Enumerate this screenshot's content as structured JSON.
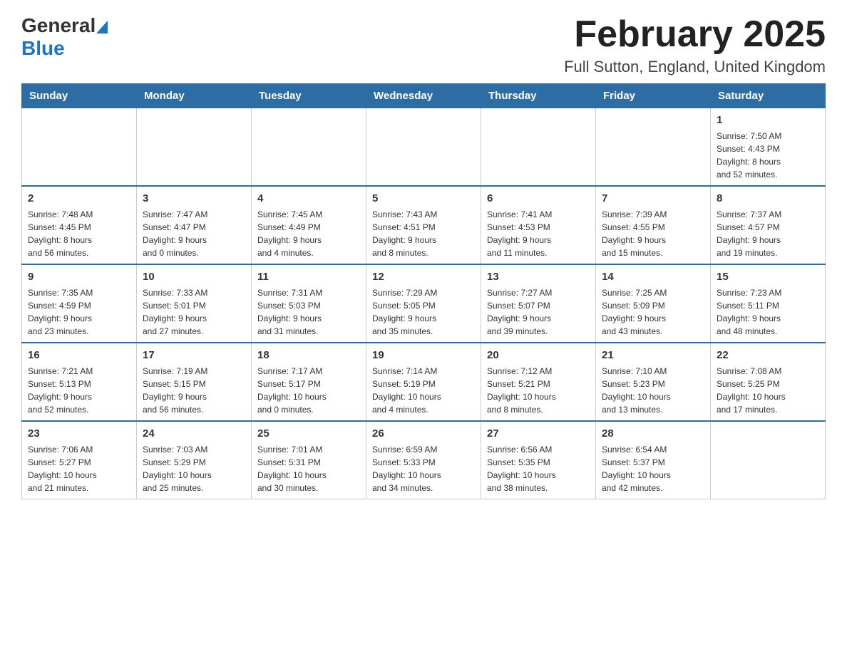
{
  "header": {
    "logo_general": "General",
    "logo_blue": "Blue",
    "month_title": "February 2025",
    "location": "Full Sutton, England, United Kingdom"
  },
  "weekdays": [
    "Sunday",
    "Monday",
    "Tuesday",
    "Wednesday",
    "Thursday",
    "Friday",
    "Saturday"
  ],
  "weeks": [
    [
      {
        "day": "",
        "info": ""
      },
      {
        "day": "",
        "info": ""
      },
      {
        "day": "",
        "info": ""
      },
      {
        "day": "",
        "info": ""
      },
      {
        "day": "",
        "info": ""
      },
      {
        "day": "",
        "info": ""
      },
      {
        "day": "1",
        "info": "Sunrise: 7:50 AM\nSunset: 4:43 PM\nDaylight: 8 hours\nand 52 minutes."
      }
    ],
    [
      {
        "day": "2",
        "info": "Sunrise: 7:48 AM\nSunset: 4:45 PM\nDaylight: 8 hours\nand 56 minutes."
      },
      {
        "day": "3",
        "info": "Sunrise: 7:47 AM\nSunset: 4:47 PM\nDaylight: 9 hours\nand 0 minutes."
      },
      {
        "day": "4",
        "info": "Sunrise: 7:45 AM\nSunset: 4:49 PM\nDaylight: 9 hours\nand 4 minutes."
      },
      {
        "day": "5",
        "info": "Sunrise: 7:43 AM\nSunset: 4:51 PM\nDaylight: 9 hours\nand 8 minutes."
      },
      {
        "day": "6",
        "info": "Sunrise: 7:41 AM\nSunset: 4:53 PM\nDaylight: 9 hours\nand 11 minutes."
      },
      {
        "day": "7",
        "info": "Sunrise: 7:39 AM\nSunset: 4:55 PM\nDaylight: 9 hours\nand 15 minutes."
      },
      {
        "day": "8",
        "info": "Sunrise: 7:37 AM\nSunset: 4:57 PM\nDaylight: 9 hours\nand 19 minutes."
      }
    ],
    [
      {
        "day": "9",
        "info": "Sunrise: 7:35 AM\nSunset: 4:59 PM\nDaylight: 9 hours\nand 23 minutes."
      },
      {
        "day": "10",
        "info": "Sunrise: 7:33 AM\nSunset: 5:01 PM\nDaylight: 9 hours\nand 27 minutes."
      },
      {
        "day": "11",
        "info": "Sunrise: 7:31 AM\nSunset: 5:03 PM\nDaylight: 9 hours\nand 31 minutes."
      },
      {
        "day": "12",
        "info": "Sunrise: 7:29 AM\nSunset: 5:05 PM\nDaylight: 9 hours\nand 35 minutes."
      },
      {
        "day": "13",
        "info": "Sunrise: 7:27 AM\nSunset: 5:07 PM\nDaylight: 9 hours\nand 39 minutes."
      },
      {
        "day": "14",
        "info": "Sunrise: 7:25 AM\nSunset: 5:09 PM\nDaylight: 9 hours\nand 43 minutes."
      },
      {
        "day": "15",
        "info": "Sunrise: 7:23 AM\nSunset: 5:11 PM\nDaylight: 9 hours\nand 48 minutes."
      }
    ],
    [
      {
        "day": "16",
        "info": "Sunrise: 7:21 AM\nSunset: 5:13 PM\nDaylight: 9 hours\nand 52 minutes."
      },
      {
        "day": "17",
        "info": "Sunrise: 7:19 AM\nSunset: 5:15 PM\nDaylight: 9 hours\nand 56 minutes."
      },
      {
        "day": "18",
        "info": "Sunrise: 7:17 AM\nSunset: 5:17 PM\nDaylight: 10 hours\nand 0 minutes."
      },
      {
        "day": "19",
        "info": "Sunrise: 7:14 AM\nSunset: 5:19 PM\nDaylight: 10 hours\nand 4 minutes."
      },
      {
        "day": "20",
        "info": "Sunrise: 7:12 AM\nSunset: 5:21 PM\nDaylight: 10 hours\nand 8 minutes."
      },
      {
        "day": "21",
        "info": "Sunrise: 7:10 AM\nSunset: 5:23 PM\nDaylight: 10 hours\nand 13 minutes."
      },
      {
        "day": "22",
        "info": "Sunrise: 7:08 AM\nSunset: 5:25 PM\nDaylight: 10 hours\nand 17 minutes."
      }
    ],
    [
      {
        "day": "23",
        "info": "Sunrise: 7:06 AM\nSunset: 5:27 PM\nDaylight: 10 hours\nand 21 minutes."
      },
      {
        "day": "24",
        "info": "Sunrise: 7:03 AM\nSunset: 5:29 PM\nDaylight: 10 hours\nand 25 minutes."
      },
      {
        "day": "25",
        "info": "Sunrise: 7:01 AM\nSunset: 5:31 PM\nDaylight: 10 hours\nand 30 minutes."
      },
      {
        "day": "26",
        "info": "Sunrise: 6:59 AM\nSunset: 5:33 PM\nDaylight: 10 hours\nand 34 minutes."
      },
      {
        "day": "27",
        "info": "Sunrise: 6:56 AM\nSunset: 5:35 PM\nDaylight: 10 hours\nand 38 minutes."
      },
      {
        "day": "28",
        "info": "Sunrise: 6:54 AM\nSunset: 5:37 PM\nDaylight: 10 hours\nand 42 minutes."
      },
      {
        "day": "",
        "info": ""
      }
    ]
  ]
}
